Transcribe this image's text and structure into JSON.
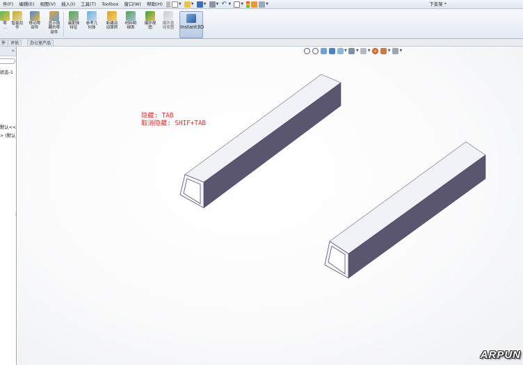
{
  "menubar": {
    "items": [
      "件(F)",
      "编辑(E)",
      "视图(V)",
      "插入(I)",
      "工具(T)",
      "Toolbox",
      "窗口(W)",
      "帮助(H)"
    ],
    "document_title": "下支架 *"
  },
  "commands": {
    "items": [
      {
        "label": "零\n…",
        "icon": "insert-component-icon"
      },
      {
        "label": "智能扣\n件",
        "icon": "smart-fasteners-icon"
      },
      {
        "label": "移动零\n部件",
        "icon": "move-component-icon"
      },
      {
        "label": "显示隐\n藏的零\n部件",
        "icon": "show-hidden-components-icon"
      },
      {
        "label": "装配体\n特征",
        "icon": "assembly-features-icon"
      },
      {
        "label": "参考几\n何体",
        "icon": "reference-geometry-icon"
      },
      {
        "label": "新建运\n动算例",
        "icon": "new-motion-study-icon"
      },
      {
        "label": "材料明\n细表",
        "icon": "bill-of-materials-icon"
      },
      {
        "label": "爆炸视\n图",
        "icon": "exploded-view-icon"
      },
      {
        "label": "爆炸直\n线草图",
        "icon": "explode-line-sketch-icon"
      }
    ],
    "instant3d": "Instant3D"
  },
  "tabs": [
    "件",
    "评估",
    "办公室产品"
  ],
  "feature_tree": {
    "expand_glyph": "»",
    "lines": [
      "状态-1",
      "默认<<",
      "> (默认"
    ]
  },
  "viewport": {
    "hint_lines": [
      "隐藏: TAB",
      "取消隐藏: SHIF+TAB"
    ],
    "hint_color": "#e0302c",
    "part_face_color": "#f1f1f8",
    "part_side_color": "#5a5670"
  },
  "watermark": "ARPUN"
}
